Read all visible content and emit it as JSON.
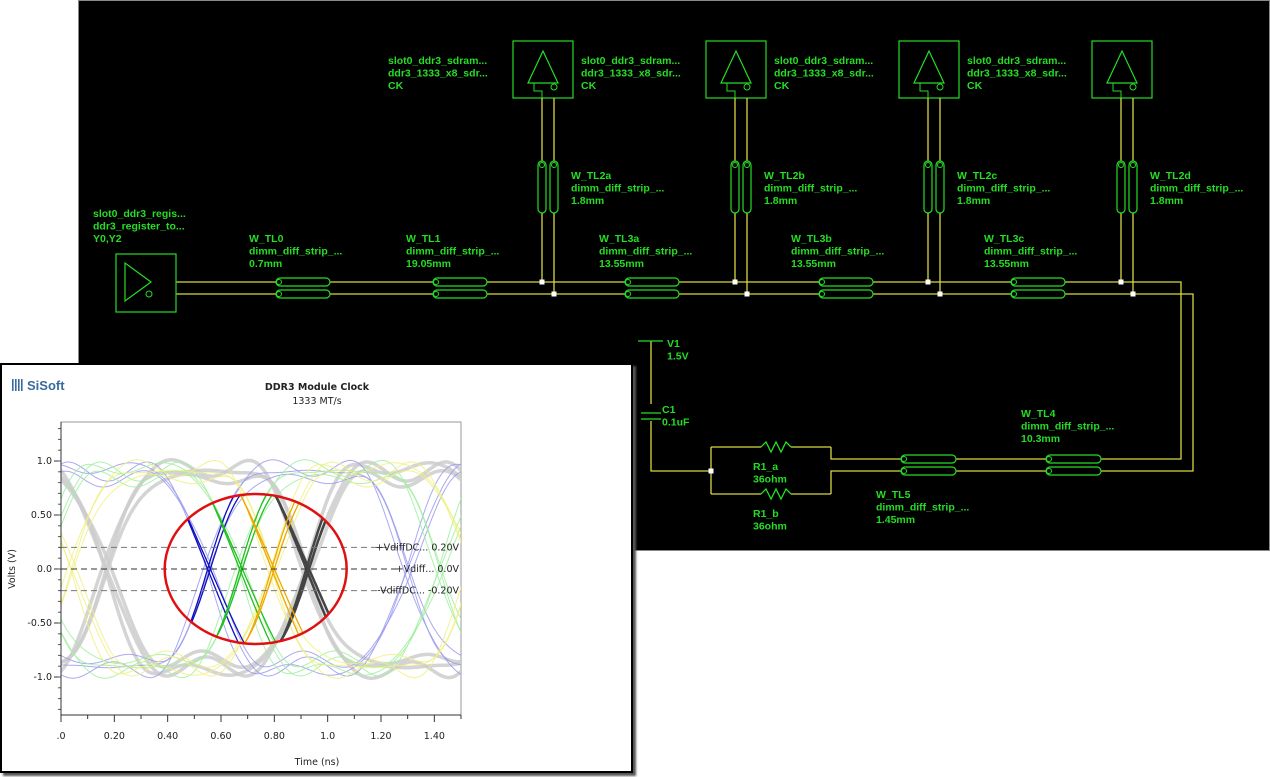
{
  "schematic": {
    "driver": {
      "lines": [
        "slot0_ddr3_regis...",
        "ddr3_register_to...",
        "Y0,Y2"
      ]
    },
    "receivers": [
      {
        "lines": [
          "slot0_ddr3_sdram...",
          "ddr3_1333_x8_sdr...",
          "CK"
        ]
      },
      {
        "lines": [
          "slot0_ddr3_sdram...",
          "ddr3_1333_x8_sdr...",
          "CK"
        ]
      },
      {
        "lines": [
          "slot0_ddr3_sdram...",
          "ddr3_1333_x8_sdr...",
          "CK"
        ]
      },
      {
        "lines": [
          "slot0_ddr3_sdram...",
          "ddr3_1333_x8_sdr...",
          "CK"
        ]
      }
    ],
    "hlines": [
      {
        "lines": [
          "W_TL0",
          "dimm_diff_strip_...",
          "0.7mm"
        ]
      },
      {
        "lines": [
          "W_TL1",
          "dimm_diff_strip_...",
          "19.05mm"
        ]
      },
      {
        "lines": [
          "W_TL3a",
          "dimm_diff_strip_...",
          "13.55mm"
        ]
      },
      {
        "lines": [
          "W_TL3b",
          "dimm_diff_strip_...",
          "13.55mm"
        ]
      },
      {
        "lines": [
          "W_TL3c",
          "dimm_diff_strip_...",
          "13.55mm"
        ]
      }
    ],
    "vlines": [
      {
        "lines": [
          "W_TL2a",
          "dimm_diff_strip_...",
          "1.8mm"
        ]
      },
      {
        "lines": [
          "W_TL2b",
          "dimm_diff_strip_...",
          "1.8mm"
        ]
      },
      {
        "lines": [
          "W_TL2c",
          "dimm_diff_strip_...",
          "1.8mm"
        ]
      },
      {
        "lines": [
          "W_TL2d",
          "dimm_diff_strip_...",
          "1.8mm"
        ]
      }
    ],
    "term": [
      {
        "lines": [
          "V1",
          "1.5V"
        ]
      },
      {
        "lines": [
          "C1",
          "0.1uF"
        ]
      },
      {
        "lines": [
          "R1_a",
          "36ohm"
        ]
      },
      {
        "lines": [
          "R1_b",
          "36ohm"
        ]
      },
      {
        "lines": [
          "W_TL5",
          "dimm_diff_strip_...",
          "1.45mm"
        ]
      },
      {
        "lines": [
          "W_TL4",
          "dimm_diff_strip_...",
          "10.3mm"
        ]
      }
    ],
    "colors": {
      "component": "#25dd25",
      "wire": "#d8d840",
      "background": "#000000"
    }
  },
  "chart_panel": {
    "logo": "SiSoft",
    "chart_data": {
      "type": "line",
      "subtype": "eye-diagram",
      "title": "DDR3 Module Clock",
      "subtitle": "1333 MT/s",
      "xlabel": "Time (ns)",
      "ylabel": "Volts (V)",
      "xlim": [
        0,
        1.5
      ],
      "ylim": [
        -1.36,
        1.36
      ],
      "xticks": [
        ".0",
        "0.20",
        "0.40",
        "0.60",
        "0.80",
        "1.0",
        "1.20",
        "1.40"
      ],
      "xtick_values": [
        0,
        0.2,
        0.4,
        0.6,
        0.8,
        1.0,
        1.2,
        1.4
      ],
      "yticks": [
        "1.0",
        "0.50",
        "0.0",
        "-0.50",
        "-1.0"
      ],
      "ytick_values": [
        1.0,
        0.5,
        0.0,
        -0.5,
        -1.0
      ],
      "unit_interval_ns": 0.75,
      "series": [
        {
          "name": "gray",
          "color": "#cccccc",
          "highlight": "#444444",
          "crossing_ns": [
            0.17,
            0.92
          ]
        },
        {
          "name": "blue",
          "color": "#9a9aee",
          "highlight": "#1010c0",
          "crossing_ns": [
            0.55,
            1.3
          ]
        },
        {
          "name": "green",
          "color": "#a0eea0",
          "highlight": "#20c020",
          "crossing_ns": [
            0.67,
            1.42
          ]
        },
        {
          "name": "yellow",
          "color": "#f0f080",
          "highlight": "#f0a800",
          "crossing_ns": [
            0.04,
            0.79
          ]
        }
      ],
      "reference_lines": [
        {
          "label": "+VdiffDC... 0.20V",
          "value": 0.2
        },
        {
          "label": "+Vdiff... 0.0V",
          "value": 0.0
        },
        {
          "label": "-VdiffDC... -0.20V",
          "value": -0.2
        }
      ],
      "annotation": {
        "shape": "ellipse",
        "color": "#e01010",
        "center_ns": 0.73,
        "center_v": 0.0
      }
    }
  }
}
